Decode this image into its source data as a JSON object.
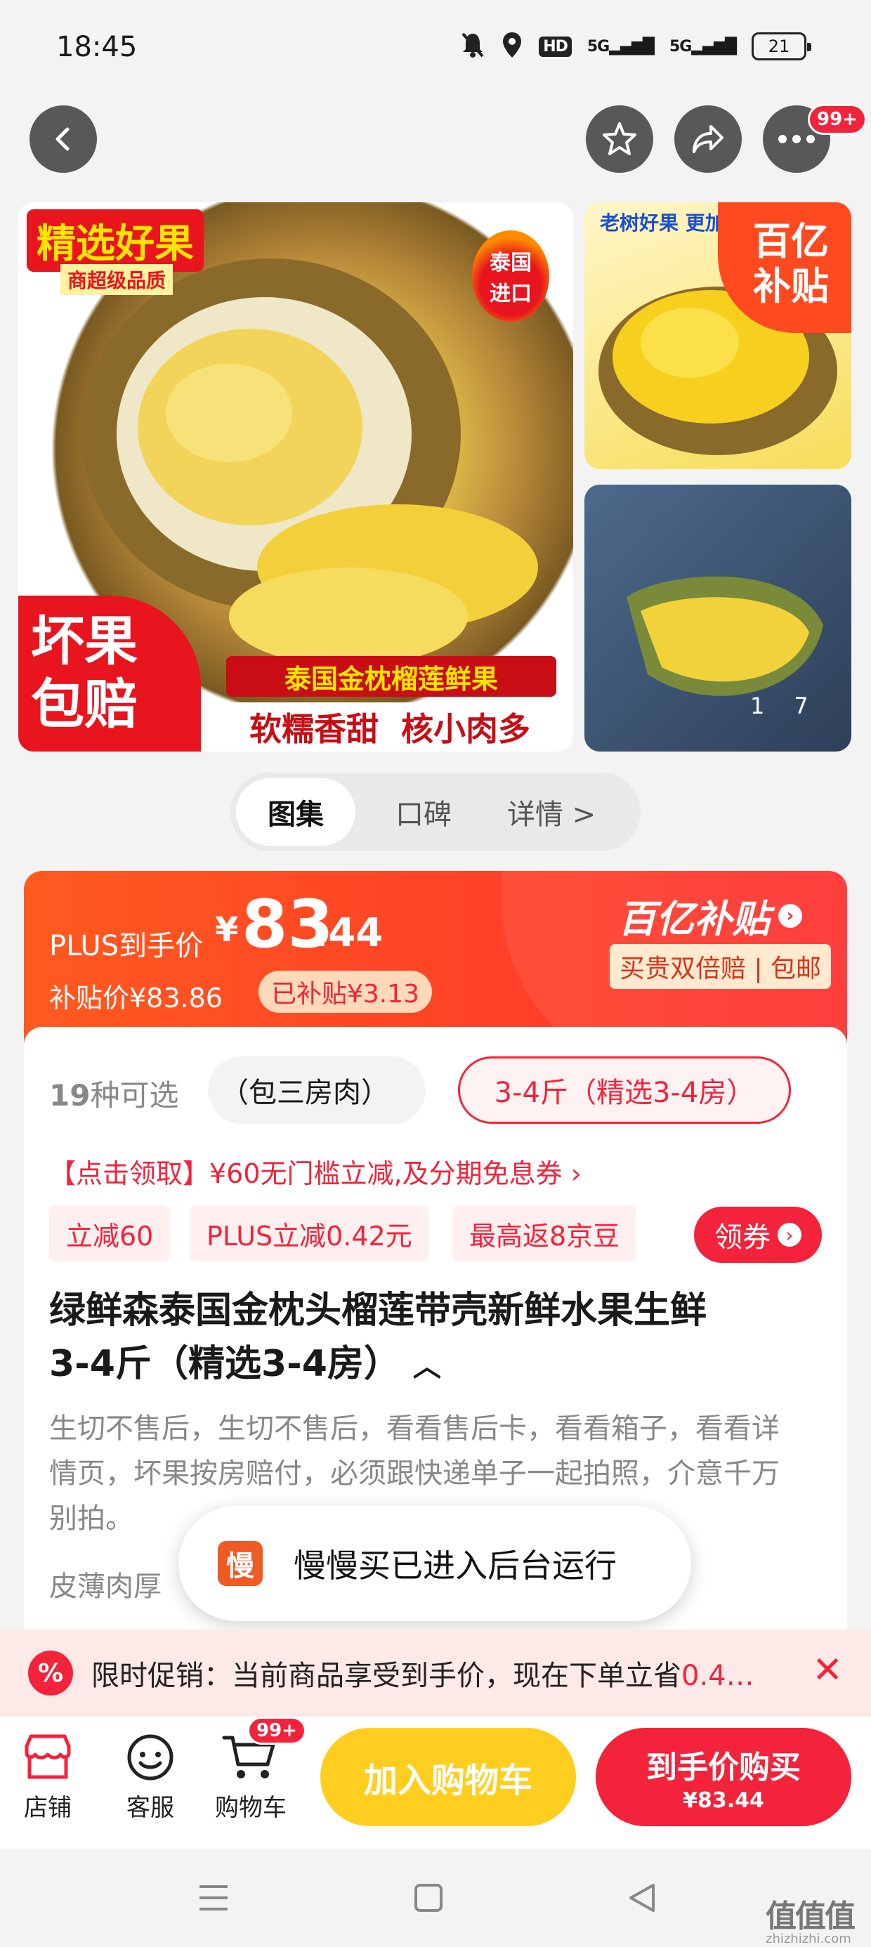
{
  "status_bar": {
    "time": "18:45",
    "network1": "5G",
    "network2": "5G",
    "hd": "HD",
    "battery": "21"
  },
  "nav": {
    "badge": "99+",
    "back_icon": "back-arrow-icon",
    "star_icon": "star-icon",
    "share_icon": "share-icon",
    "more_icon": "more-icon"
  },
  "gallery": {
    "main": {
      "title": "精选好果",
      "subtitle": "商超级品质",
      "origin": "泰国\n进口",
      "guarantee_1": "坏果",
      "guarantee_2": "包赔",
      "banner": "泰国金枕榴莲鲜果",
      "slogan": "软糯香甜  核小肉多"
    },
    "side1": {
      "caption": "老树好果  更加",
      "badge_1": "百亿",
      "badge_2": "补贴"
    },
    "side2": {
      "current": "1",
      "total": "7"
    }
  },
  "tabs": [
    {
      "label": "图集",
      "active": true
    },
    {
      "label": "口碑"
    },
    {
      "label": "详情 >"
    }
  ],
  "price": {
    "plus_label": "PLUS到手价",
    "currency": "¥",
    "int": "83",
    "dec": ".44",
    "subsidy_label": "补贴价¥83.86",
    "subsidy_tag": "已补贴¥3.13",
    "brand": "百亿补贴",
    "guarantee": "买贵双倍赔 | 包邮"
  },
  "variants": {
    "count_num": "19",
    "count_text": "种可选",
    "option1": "（包三房肉）",
    "option2": "3-4斤（精选3-4房）"
  },
  "coupon_link": "【点击领取】¥60无门槛立减,及分期免息券 ›",
  "chips": [
    "立减60",
    "PLUS立减0.42元",
    "最高返8京豆"
  ],
  "coupon_button": "领券",
  "title": [
    "绿鲜森泰国金枕头榴莲带壳新鲜水果生鲜",
    "3-4斤（精选3-4房）"
  ],
  "desc": [
    "生切不售后，生切不售后，看看售后卡，看看箱子，看看详",
    "情页，坏果按房赔付，必须跟快递单子一起拍照，介意千万",
    "别拍。"
  ],
  "feature": "皮薄肉厚",
  "toast": {
    "icon_char": "慢",
    "text": "慢慢买已进入后台运行"
  },
  "promo": {
    "text": "限时促销：当前商品享受到手价，现在下单立省",
    "highlight": "0.4…"
  },
  "bottom": {
    "shop": "店铺",
    "service": "客服",
    "cart": "购物车",
    "cart_badge": "99+",
    "add_cart": "加入购物车",
    "buy_now": "到手价购买",
    "buy_price": "¥83.44"
  },
  "watermark": "值值值",
  "watermark_url": "zhizhizhi.com",
  "colors": {
    "accent": "#f2233b",
    "orange": "#ff5a1f",
    "yellow": "#ffce1f"
  }
}
